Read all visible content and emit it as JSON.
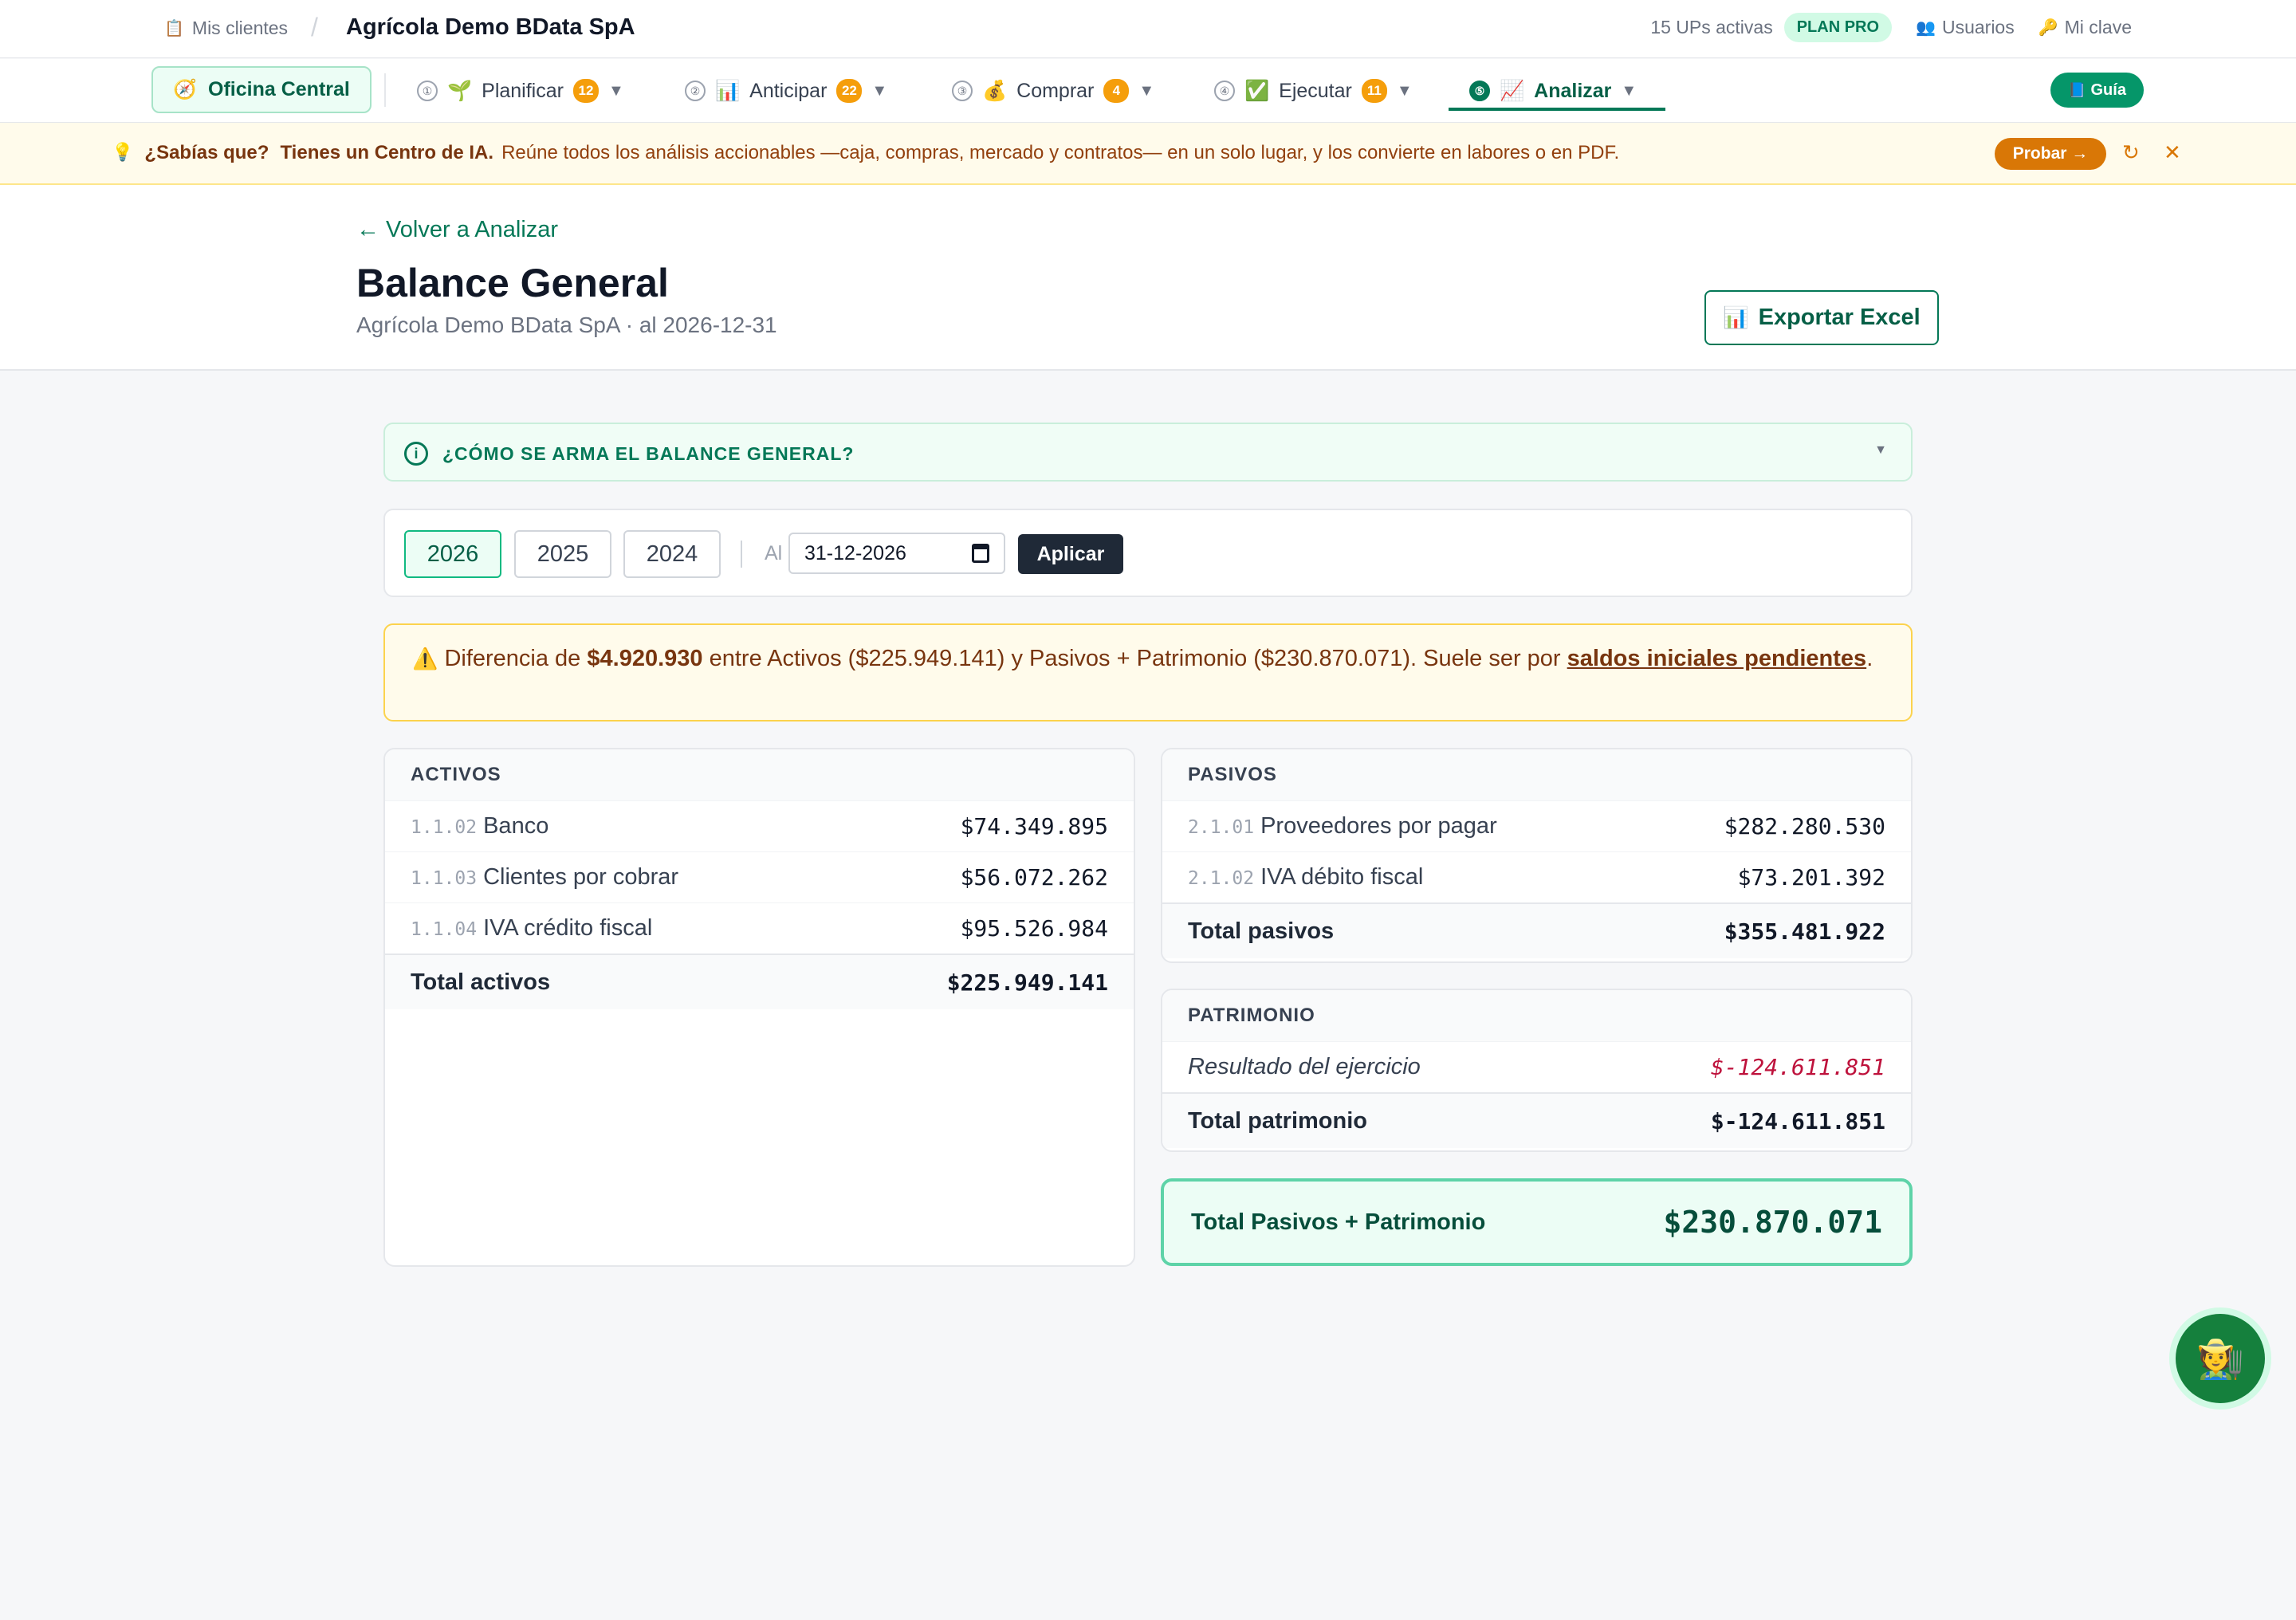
{
  "topbar": {
    "clients_icon": "clipboard-icon",
    "clients_label": "Mis clientes",
    "separator": "/",
    "company": "Agrícola Demo BData SpA",
    "active_ups": "15 UPs activas",
    "plan_badge": "PLAN PRO",
    "users_label": "Usuarios",
    "password_label": "Mi clave"
  },
  "nav": {
    "office_label": "Oficina Central",
    "items": [
      {
        "num": "①",
        "label": "Planificar",
        "badge": "12"
      },
      {
        "num": "②",
        "label": "Anticipar",
        "badge": "22"
      },
      {
        "num": "③",
        "label": "Comprar",
        "badge": "4"
      },
      {
        "num": "④",
        "label": "Ejecutar",
        "badge": "11"
      },
      {
        "num": "⑤",
        "label": "Analizar",
        "badge": ""
      }
    ],
    "guide_label": "Guía"
  },
  "tip": {
    "question": "¿Sabías que?",
    "lead": "Tienes un Centro de IA.",
    "text": "Reúne todos los análisis accionables —caja, compras, mercado y contratos— en un solo lugar, y los convierte en labores o en PDF.",
    "try_label": "Probar →"
  },
  "header": {
    "back_label": "← Volver a Analizar",
    "title": "Balance General",
    "subtitle": "Agrícola Demo BData SpA · al 2026-12-31",
    "export_label": "Exportar Excel"
  },
  "howto": {
    "label": "¿CÓMO SE ARMA EL BALANCE GENERAL?"
  },
  "filter": {
    "years": [
      "2026",
      "2025",
      "2024"
    ],
    "selected_year": "2026",
    "date_prefix": "Al",
    "date_value": "31-12-2026",
    "apply_label": "Aplicar"
  },
  "warning": {
    "prefix": "Diferencia de",
    "difference": "$4.920.930",
    "middle": "entre Activos ($225.949.141) y Pasivos + Patrimonio ($230.870.071). Suele ser por",
    "link": "saldos iniciales pendientes",
    "suffix": "."
  },
  "assets": {
    "title": "ACTIVOS",
    "rows": [
      {
        "code": "1.1.02",
        "name": "Banco",
        "amount": "$74.349.895"
      },
      {
        "code": "1.1.03",
        "name": "Clientes por cobrar",
        "amount": "$56.072.262"
      },
      {
        "code": "1.1.04",
        "name": "IVA crédito fiscal",
        "amount": "$95.526.984"
      }
    ],
    "total_label": "Total activos",
    "total_amount": "$225.949.141"
  },
  "liabilities": {
    "title": "PASIVOS",
    "rows": [
      {
        "code": "2.1.01",
        "name": "Proveedores por pagar",
        "amount": "$282.280.530"
      },
      {
        "code": "2.1.02",
        "name": "IVA débito fiscal",
        "amount": "$73.201.392"
      }
    ],
    "total_label": "Total pasivos",
    "total_amount": "$355.481.922"
  },
  "equity": {
    "title": "PATRIMONIO",
    "rows": [
      {
        "name": "Resultado del ejercicio",
        "amount": "$-124.611.851"
      }
    ],
    "total_label": "Total patrimonio",
    "total_amount": "$-124.611.851"
  },
  "grand_total": {
    "label": "Total Pasivos + Patrimonio",
    "amount": "$230.870.071"
  },
  "colors": {
    "brand_green": "#047857",
    "warning_amber": "#d97706",
    "negative_red": "#be123c"
  }
}
